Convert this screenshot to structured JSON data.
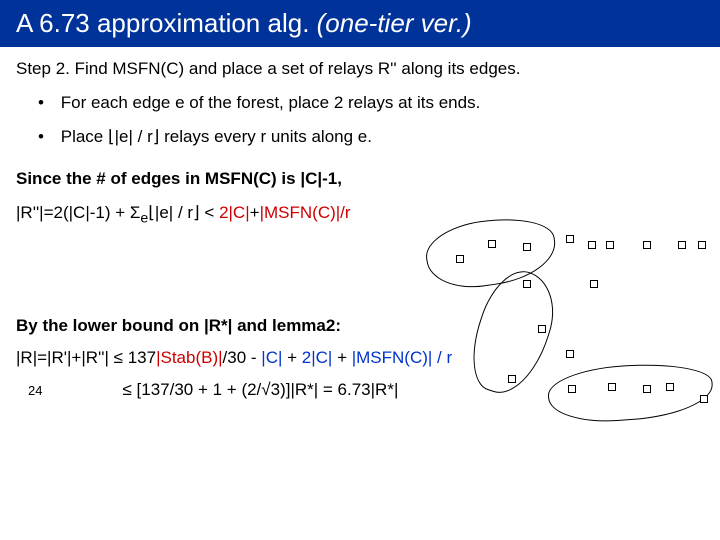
{
  "title": {
    "main": "A 6.73 approximation alg. ",
    "italic": "(one-tier ver.)"
  },
  "step": "Step 2. Find MSFN(C) and place a set of relays R'' along its edges.",
  "bullets": [
    "For each edge e of the forest, place 2 relays at its ends.",
    "Place ⌊|e| / r⌋ relays every r units along e."
  ],
  "since": "Since the # of edges in MSFN(C) is |C|-1,",
  "rprime": {
    "lhs": "|R''|=2(|C|-1) + Σ",
    "sub": "e",
    "mid": "⌊|e| / r⌋ < ",
    "red1": "2|C|",
    "plus": "+",
    "red2": "|MSFN(C)|/r"
  },
  "lower": "By the lower bound on |R*| and lemma2:",
  "reqline": {
    "lhs": "|R|=|R'|+|R''| ≤ ",
    "part1": "137",
    "red_stab": "|Stab(B)|",
    "part2": "/30 - ",
    "blue_c": "|C|",
    "part3": " + ",
    "blue_2c": "2|C|",
    "part4": " + ",
    "blue_msfn": "|MSFN(C)| / r"
  },
  "pagenum": "24",
  "final": "≤ [137/30 + 1 + (2/√3)]|R*| = 6.73|R*|"
}
